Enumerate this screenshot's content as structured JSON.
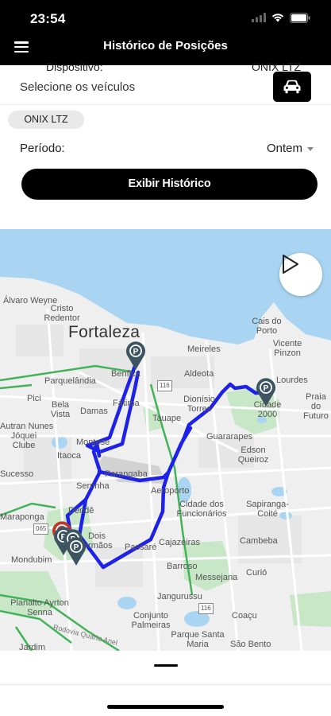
{
  "status_bar": {
    "time": "23:54"
  },
  "header": {
    "title": "Histórico de Posições"
  },
  "vehicle_selector": {
    "label": "Selecione os veículos"
  },
  "selected_vehicle_chip": "ONIX LTZ",
  "period": {
    "label": "Período:",
    "value": "Ontem"
  },
  "show_history_button": "Exibir Histórico",
  "map": {
    "city_label": "Fortaleza",
    "labels": [
      "Álvaro Weyne",
      "Cristo Redentor",
      "Cais do Porto",
      "Vicente Pinzon",
      "Parquelândia",
      "Benfica",
      "Meireles",
      "Aldeota",
      "Lourdes",
      "Pici",
      "Bela Vista",
      "Damas",
      "Fátima",
      "Dionísio Torres",
      "Cidade 2000",
      "Praia do Futuro",
      "Jóquei Clube",
      "Itaoca",
      "Montese",
      "Tauape",
      "Guararapes",
      "Edson Queiroz",
      "Autran Nunes",
      "Sucesso",
      "Serrinha",
      "Aeroporto",
      "Parangaba",
      "Dendê",
      "Dois Irmãos",
      "Cidade dos Funcionários",
      "Sapiranga-Coité",
      "Maraponga",
      "Passaré",
      "Cajazeiras",
      "Cambeba",
      "Mondubim",
      "Barroso",
      "Curió",
      "Messejana",
      "Jangurussu",
      "Planalto Ayrton Senna",
      "Conjunto Palmeiras",
      "Coaçu",
      "Parque Santa Maria",
      "São Bento",
      "Jardim",
      "Rodovia Quarto Anel"
    ],
    "road_shields": [
      "116",
      "116",
      "065"
    ]
  },
  "bottom_sheet": {
    "device_label": "Dispositivo:",
    "device_value": "ONIX LTZ"
  },
  "colors": {
    "route": "#1e22e8",
    "marker": "#3d5561",
    "park_area": "#c7e7c7",
    "water": "#a9d5f2"
  },
  "icons": [
    "menu-icon",
    "car-icon",
    "play-icon",
    "parking-marker-icon",
    "signal-icon",
    "wifi-icon",
    "battery-icon"
  ]
}
